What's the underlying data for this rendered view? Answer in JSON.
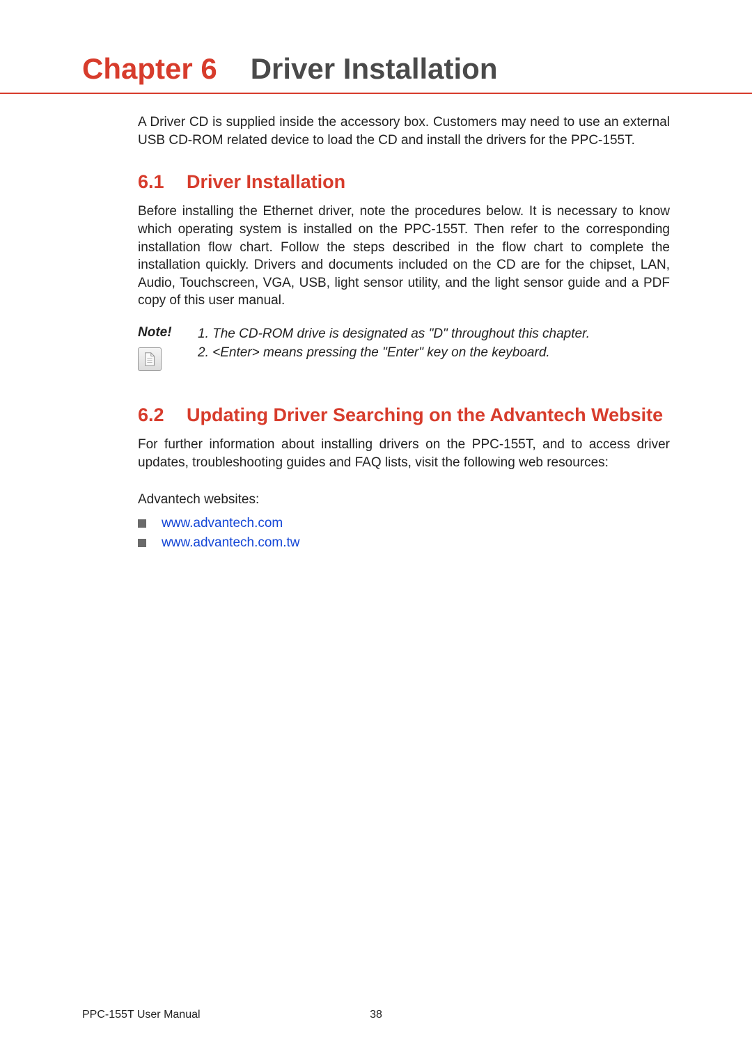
{
  "chapter": {
    "label": "Chapter 6",
    "title": "Driver Installation"
  },
  "intro": "A Driver CD is supplied inside the accessory box. Customers may need to use an external USB CD-ROM related device to load the CD and install the drivers for the PPC-155T.",
  "sections": {
    "s1": {
      "number": "6.1",
      "title": "Driver Installation",
      "body": "Before installing the Ethernet driver, note the procedures below. It is necessary to know which operating system is installed on the PPC-155T. Then refer to the corresponding installation flow chart. Follow the steps described in the flow chart to complete the installation quickly. Drivers and documents included on the CD are for the chipset, LAN, Audio, Touchscreen, VGA, USB, light sensor utility, and the light sensor guide and a PDF copy of this user manual.",
      "note": {
        "label": "Note!",
        "item1": "1. The CD-ROM drive is designated as \"D\" throughout this chapter.",
        "item2": "2. <Enter> means pressing the \"Enter\" key on the keyboard."
      }
    },
    "s2": {
      "number": "6.2",
      "title": "Updating Driver Searching on the Advantech Website",
      "body": "For further information about installing drivers on the PPC-155T, and to access driver updates, troubleshooting guides and FAQ lists, visit the following web resources:",
      "websites_label": "Advantech websites:",
      "links": {
        "link1": "www.advantech.com",
        "link2": "www.advantech.com.tw"
      }
    }
  },
  "footer": {
    "manual": "PPC-155T User Manual",
    "page": "38"
  }
}
